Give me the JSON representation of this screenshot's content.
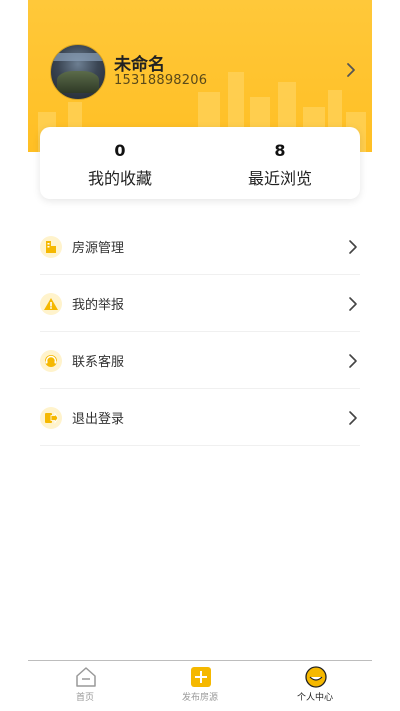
{
  "profile": {
    "name": "未命名",
    "phone": "15318898206"
  },
  "stats": [
    {
      "value": "0",
      "label": "我的收藏"
    },
    {
      "value": "8",
      "label": "最近浏览"
    }
  ],
  "menu": [
    {
      "label": "房源管理",
      "icon": "building-icon"
    },
    {
      "label": "我的举报",
      "icon": "warning-icon"
    },
    {
      "label": "联系客服",
      "icon": "headset-icon"
    },
    {
      "label": "退出登录",
      "icon": "logout-icon"
    }
  ],
  "tabs": [
    {
      "label": "首页",
      "icon": "home-icon",
      "active": false
    },
    {
      "label": "发布房源",
      "icon": "plus-icon",
      "active": false
    },
    {
      "label": "个人中心",
      "icon": "smile-icon",
      "active": true
    }
  ],
  "colors": {
    "accent": "#ffc83a",
    "accent_dark": "#f5b800"
  }
}
